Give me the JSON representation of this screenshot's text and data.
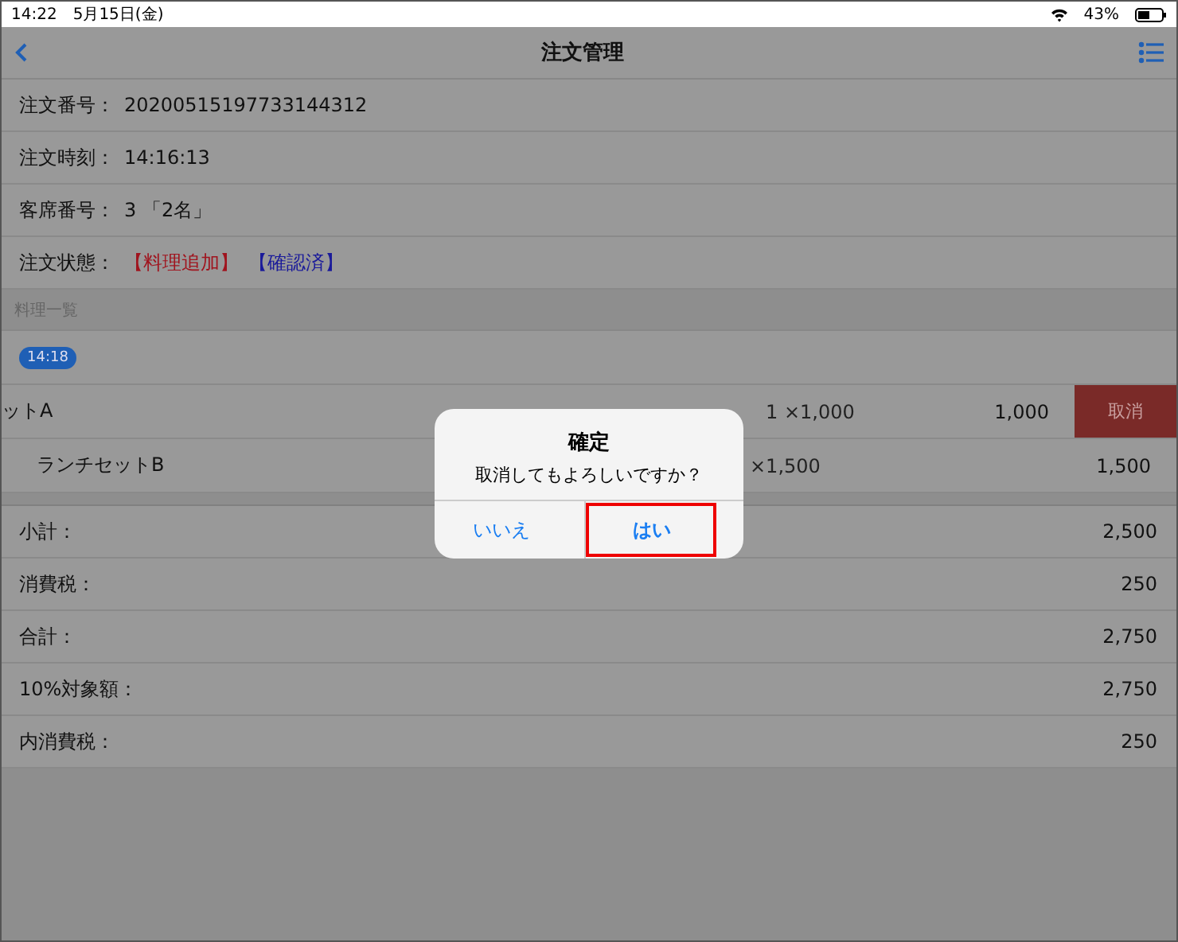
{
  "status_bar": {
    "time": "14:22",
    "date": "5月15日(金)",
    "battery": "43%"
  },
  "nav": {
    "title": "注文管理"
  },
  "info_rows": [
    {
      "label": "注文番号：",
      "value": "20200515197733144312"
    },
    {
      "label": "注文時刻：",
      "value": "14:16:13"
    },
    {
      "label": "客席番号：",
      "value": "3 「2名」"
    }
  ],
  "order_state": {
    "label": "注文状態：",
    "tags": [
      {
        "text": "【料理追加】",
        "color": "#a0141e"
      },
      {
        "text": "【確認済】",
        "color": "#1a1a9a"
      }
    ]
  },
  "section_title": "料理一覧",
  "time_badge": "14:18",
  "items": [
    {
      "name": "ットA",
      "quantity": "1 ×1,000",
      "price": "1,000",
      "swiped": true,
      "action": "取消"
    },
    {
      "name": "ランチセットB",
      "quantity": "×1,500",
      "price": "1,500",
      "swiped": false
    }
  ],
  "totals": [
    {
      "label": "小計：",
      "value": "2,500"
    },
    {
      "label": "消費税：",
      "value": "250"
    },
    {
      "label": "合計：",
      "value": "2,750"
    },
    {
      "label": "10%対象額：",
      "value": "2,750"
    },
    {
      "label": "内消費税：",
      "value": "250"
    }
  ],
  "dialog": {
    "title": "確定",
    "message": "取消してもよろしいですか？",
    "buttons": [
      {
        "label": "いいえ",
        "highlighted": false
      },
      {
        "label": "はい",
        "highlighted": true
      }
    ]
  }
}
